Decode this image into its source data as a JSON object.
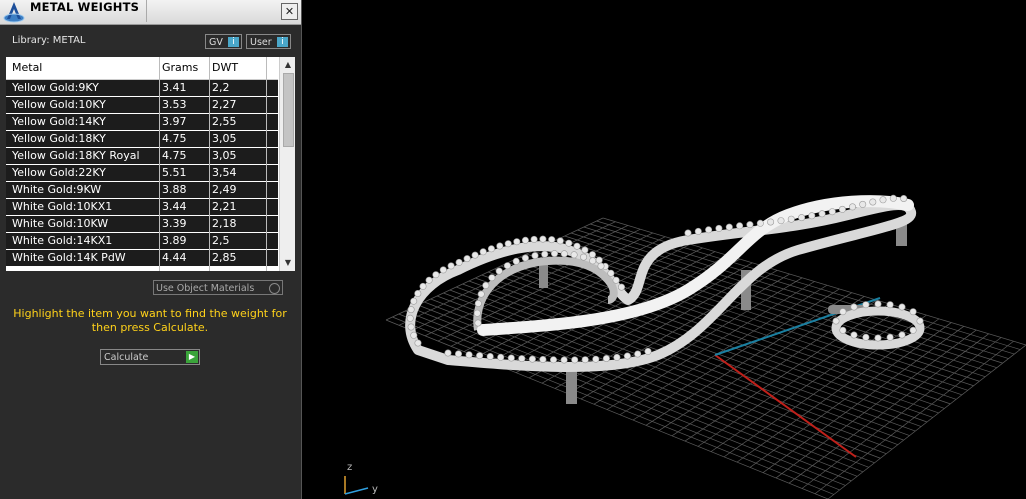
{
  "window": {
    "title": "METAL WEIGHTS",
    "close_glyph": "✕"
  },
  "library": {
    "label": "Library: METAL"
  },
  "toggles": [
    {
      "label": "GV",
      "icon": "info-icon"
    },
    {
      "label": "User",
      "icon": "info-icon"
    }
  ],
  "table": {
    "columns": [
      "Metal",
      "Grams",
      "DWT"
    ],
    "rows": [
      {
        "metal": "Yellow Gold:9KY",
        "grams": "3.41",
        "dwt": "2,2"
      },
      {
        "metal": "Yellow Gold:10KY",
        "grams": "3.53",
        "dwt": "2,27"
      },
      {
        "metal": "Yellow Gold:14KY",
        "grams": "3.97",
        "dwt": "2,55"
      },
      {
        "metal": "Yellow Gold:18KY",
        "grams": "4.75",
        "dwt": "3,05"
      },
      {
        "metal": "Yellow Gold:18KY Royal",
        "grams": "4.75",
        "dwt": "3,05"
      },
      {
        "metal": "Yellow Gold:22KY",
        "grams": "5.51",
        "dwt": "3,54"
      },
      {
        "metal": "White Gold:9KW",
        "grams": "3.88",
        "dwt": "2,49"
      },
      {
        "metal": "White Gold:10KX1",
        "grams": "3.44",
        "dwt": "2,21"
      },
      {
        "metal": "White Gold:10KW",
        "grams": "3.39",
        "dwt": "2,18"
      },
      {
        "metal": "White Gold:14KX1",
        "grams": "3.89",
        "dwt": "2,5"
      },
      {
        "metal": "White Gold:14K PdW",
        "grams": "4.44",
        "dwt": "2,85"
      }
    ]
  },
  "use_materials": {
    "label": "Use Object Materials"
  },
  "instructions": "Highlight the item you want to find the weight for then press Calculate.",
  "calculate": {
    "label": "Calculate"
  },
  "viewport": {
    "axis_z": "z",
    "axis_y": "y"
  },
  "colors": {
    "accent_yellow": "#ffd21a",
    "calc_green": "#3aa43a",
    "info_blue": "#4aa7c9",
    "axis_red": "#c0201a",
    "axis_cyan": "#1a7fa0"
  }
}
